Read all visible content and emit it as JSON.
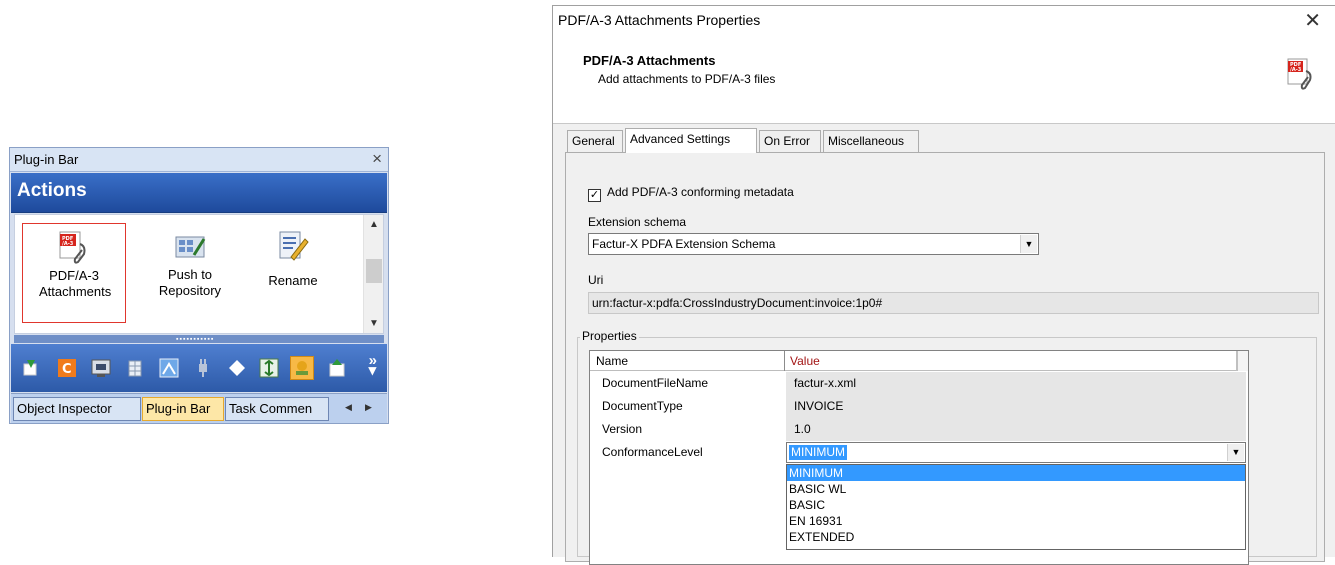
{
  "plugin_bar": {
    "title": "Plug-in Bar",
    "section_title": "Actions",
    "actions": [
      {
        "label": "PDF/A-3 Attachments",
        "icon": "pdfa3-attach-icon",
        "selected": true
      },
      {
        "label": "Push to Repository",
        "icon": "push-repository-icon",
        "selected": false
      },
      {
        "label": "Rename",
        "icon": "rename-icon",
        "selected": false
      }
    ],
    "toolbar_icons": [
      "import-icon",
      "c-icon",
      "display-icon",
      "table-icon",
      "image-icon",
      "plug-icon",
      "diamond-icon",
      "fit-icon",
      "stamp-icon",
      "export-icon"
    ],
    "toolbar_active_index": 8,
    "tabs": [
      {
        "label": "Object Inspector",
        "active": false
      },
      {
        "label": "Plug-in Bar",
        "active": true
      },
      {
        "label": "Task Commen",
        "active": false
      }
    ],
    "colors": {
      "header": "#2a5ab5",
      "toolbar": "#3e6fc2",
      "active_tab": "#fde7a7",
      "selected_border": "#e0362d"
    }
  },
  "dialog": {
    "title": "PDF/A-3 Attachments Properties",
    "header_title": "PDF/A-3 Attachments",
    "header_subtitle": "Add attachments to PDF/A-3 files",
    "tabs": [
      {
        "label": "General",
        "active": false
      },
      {
        "label": "Advanced Settings",
        "active": true
      },
      {
        "label": "On Error",
        "active": false
      },
      {
        "label": "Miscellaneous",
        "active": false
      }
    ],
    "add_metadata_checkbox": {
      "label": "Add PDF/A-3 conforming metadata",
      "checked": true
    },
    "extension_schema_label": "Extension schema",
    "extension_schema_value": "Factur-X PDFA Extension Schema",
    "uri_label": "Uri",
    "uri_value": "urn:factur-x:pdfa:CrossIndustryDocument:invoice:1p0#",
    "properties_group_label": "Properties",
    "grid_headers": {
      "name": "Name",
      "value": "Value"
    },
    "grid_rows": [
      {
        "name": "DocumentFileName",
        "value": "factur-x.xml"
      },
      {
        "name": "DocumentType",
        "value": "INVOICE"
      },
      {
        "name": "Version",
        "value": "1.0"
      },
      {
        "name": "ConformanceLevel",
        "value": "MINIMUM"
      }
    ],
    "conformance_options": [
      "MINIMUM",
      "BASIC WL",
      "BASIC",
      "EN 16931",
      "EXTENDED"
    ],
    "conformance_selected": "MINIMUM",
    "colors": {
      "selection": "#3399ff",
      "value_header": "#a31515"
    }
  }
}
